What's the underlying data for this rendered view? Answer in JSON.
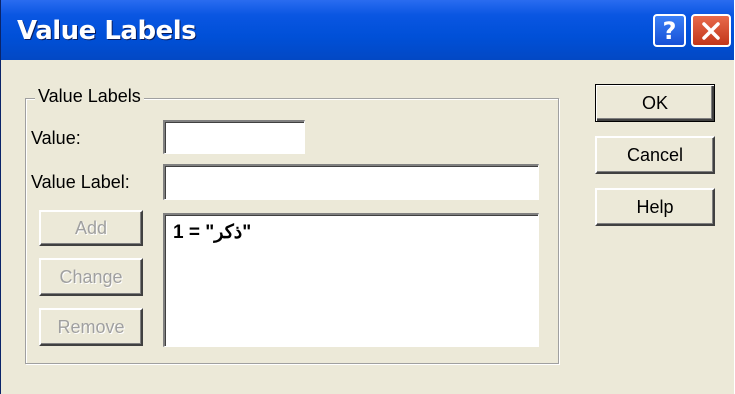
{
  "window": {
    "title": "Value Labels"
  },
  "titlebar": {
    "help_glyph": "?",
    "close_icon": "close-x"
  },
  "group": {
    "legend": "Value Labels"
  },
  "form": {
    "value_label": "Value:",
    "value_input": "",
    "value_label_label": "Value Label:",
    "value_label_input": ""
  },
  "buttons": {
    "add": "Add",
    "change": "Change",
    "remove": "Remove",
    "ok": "OK",
    "cancel": "Cancel",
    "help": "Help"
  },
  "list": {
    "items": [
      "1 = \"ذكر\""
    ]
  },
  "colors": {
    "titlebar": "#0050d8",
    "dialog_bg": "#ece9d8",
    "close": "#d4472a"
  }
}
